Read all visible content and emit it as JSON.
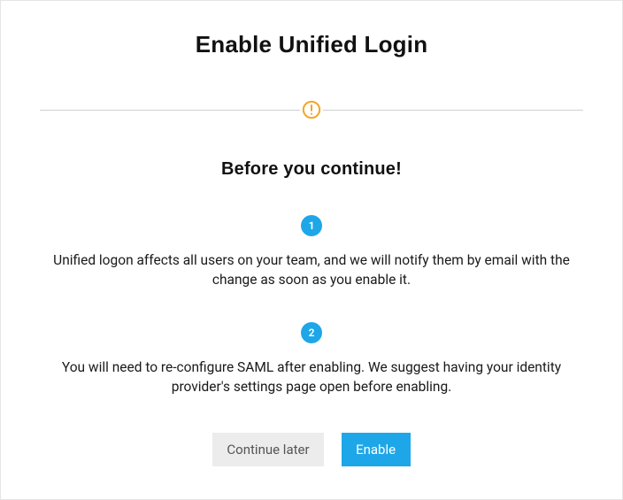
{
  "dialog": {
    "title": "Enable Unified Login",
    "subtitle": "Before you continue!",
    "steps": [
      {
        "num": "1",
        "text": "Unified logon affects all users on your team, and we will notify them by email with the change as soon as you enable it."
      },
      {
        "num": "2",
        "text": "You will need to re-configure SAML after enabling. We suggest having your identity provider's settings page open before enabling."
      }
    ],
    "actions": {
      "secondary": "Continue later",
      "primary": "Enable"
    },
    "colors": {
      "accent": "#1ea7e8",
      "warning": "#f5a623"
    }
  }
}
